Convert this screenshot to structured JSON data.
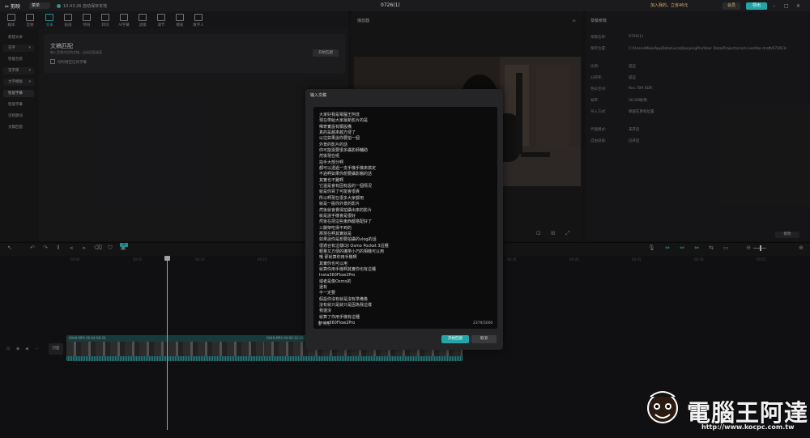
{
  "app": {
    "name": "剪映",
    "menu": "菜单",
    "autosave": "10:43:26 自动保存本地",
    "project_title": "0726(1)",
    "upgrade_text": "加入我的，立省46元",
    "pro_label": "会员",
    "export_label": "导出"
  },
  "tool_tabs": [
    "媒体",
    "音频",
    "文本",
    "贴纸",
    "特效",
    "转场",
    "AI字幕",
    "滤镜",
    "调节",
    "模板",
    "数字人"
  ],
  "active_tool": "文本",
  "sidebar": {
    "items": [
      {
        "label": "新建文本",
        "type": "plain"
      },
      {
        "label": "花字",
        "type": "dropdown"
      },
      {
        "label": "智能包装",
        "type": "plain"
      },
      {
        "label": "花字库",
        "type": "dropdown"
      },
      {
        "label": "文字模板",
        "type": "dropdown"
      },
      {
        "label": "智能字幕",
        "type": "selected"
      },
      {
        "label": "智能字幕",
        "type": "plain"
      },
      {
        "label": "识别歌词",
        "type": "plain"
      },
      {
        "label": "文稿匹配",
        "type": "plain"
      }
    ]
  },
  "match_panel": {
    "title": "文稿匹配",
    "desc": "输入音频对应的文稿，自动匹配画面",
    "checkbox": "同时清空已有字幕",
    "start": "开始匹配"
  },
  "player": {
    "title": "播放器"
  },
  "details": {
    "title": "草稿参数",
    "rows": [
      {
        "k": "草稿名称:",
        "v": "0726(1)"
      },
      {
        "k": "保存位置:",
        "v": "C:/Users/Mike/AppData/Local/JianyingPro/User Data/Projects/com.lveditor.draft/0726(1)"
      },
      {
        "k": "比例:",
        "v": "适应"
      },
      {
        "k": "分辨率:",
        "v": "适应"
      },
      {
        "k": "色彩空间:",
        "v": "Rec.709 SDR"
      },
      {
        "k": "帧率:",
        "v": "30.00帧/秒"
      },
      {
        "k": "导入方式:",
        "v": "保留在原有位置"
      },
      {
        "k": "代理模式:",
        "v": "未开启"
      },
      {
        "k": "自由层级:",
        "v": "已开启"
      }
    ],
    "edit": "修改"
  },
  "timeline": {
    "ticks": [
      "00:00",
      "00:05",
      "00:10",
      "00:15",
      "00:20",
      "00:25",
      "00:30",
      "00:35",
      "00:40",
      "00:45",
      "00:50",
      "00:55",
      "01:00"
    ],
    "cover_label": "封面",
    "clips": [
      {
        "label": "0048.MP4  00:04:08:20"
      },
      {
        "label": "0049.MP4  00:04:12:10"
      }
    ]
  },
  "dialog": {
    "title": "输入文稿",
    "lines": [
      "大家好我是電腦王阿達",
      "現在帶給大家最新影片的是",
      "稀奇實設有關設備",
      "真的是越來越方便了",
      "以往如果說你要拍一個",
      "外景的影片的話",
      "你可能需要很多攝影師輔助",
      "然後現在呢",
      "拍手大部分啊",
      "都可以透過一支手機手機來搞定",
      "不過啊如果你想要攝影棚的話",
      "其實也不難啊",
      "它還是會有固有設的一個情況",
      "就是你買了可能會很貴",
      "所以啊現在很多大家都用",
      "就是一般你外景的影片",
      "然後就會覺得拍攝出來的影片",
      "就是說手機會是很好",
      "然後在把這些東西都搭配好了",
      "三腳架吃得不到的",
      "那現在啊其實就是",
      "如果說你是想要拍攝的vlog的話",
      "很適合有這樣DJI Osmo Pocket 3這種",
      "輕量又方便的攜帶小巧的相機可以用",
      "哦 那就算你用手機啊",
      "其實你也可以用",
      "就算你用手機啊其實你也有這種",
      "Insta360Flow2Pro",
      "或者是像Osmo的",
      "還有",
      "不一定要",
      "假設你沒有就是沒有準備像",
      "沒有就只是就只是因為我這樣",
      "我還沒",
      "就算了你用手機有這種",
      "Insta360Flow2Pro"
    ],
    "clear": "清空",
    "count": "2379/5000",
    "start": "开始匹配",
    "cancel": "取消"
  },
  "watermark": {
    "text": "電腦王阿達",
    "url": "http://www.kocpc.com.tw"
  }
}
